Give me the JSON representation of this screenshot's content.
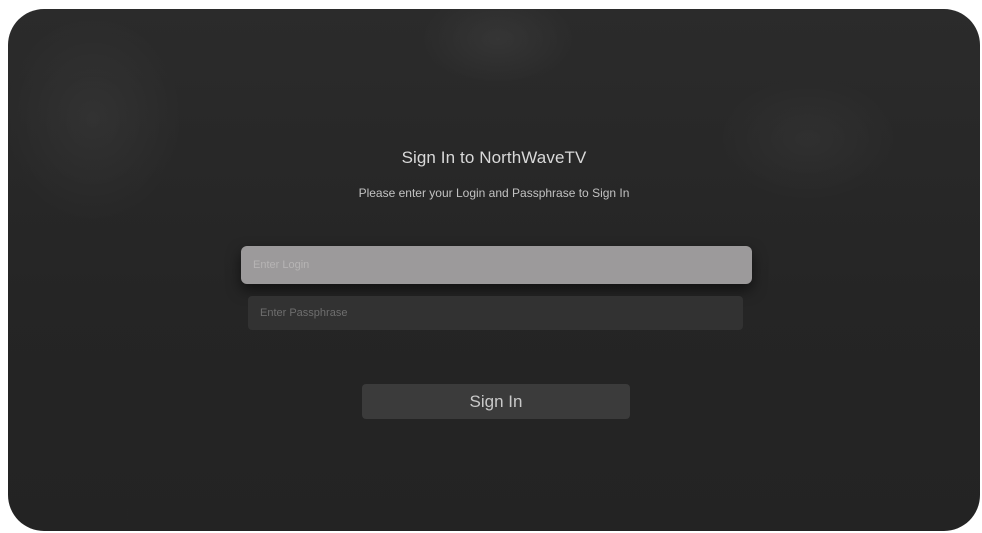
{
  "signin": {
    "title": "Sign In to NorthWaveTV",
    "subtitle": "Please enter your Login and Passphrase to Sign In",
    "login_placeholder": "Enter Login",
    "passphrase_placeholder": "Enter Passphrase",
    "button_label": "Sign In"
  },
  "colors": {
    "background": "#262626",
    "focused_field": "#9c9a9b",
    "field": "#323232",
    "button": "#3b3b3b"
  }
}
